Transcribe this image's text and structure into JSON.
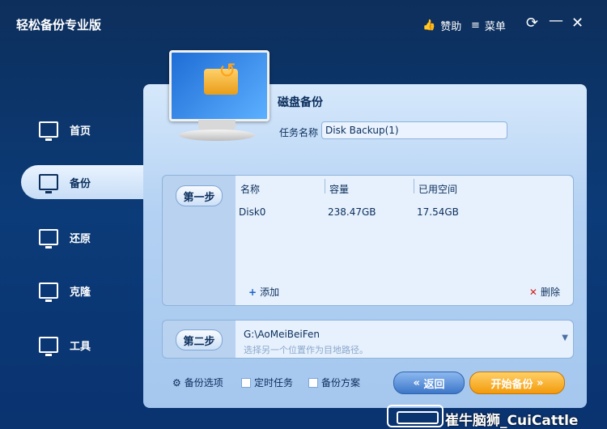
{
  "app": {
    "title": "轻松备份专业版"
  },
  "titlebar": {
    "donate_label": "赞助",
    "menu_label": "菜单",
    "refresh_icon": "refresh-icon",
    "minimize_icon": "minimize-icon",
    "close_icon": "close-icon"
  },
  "sidebar": {
    "items": [
      {
        "label": "首页",
        "icon": "home-monitor-icon",
        "active": false
      },
      {
        "label": "备份",
        "icon": "backup-monitor-icon",
        "active": true
      },
      {
        "label": "还原",
        "icon": "restore-monitor-icon",
        "active": false
      },
      {
        "label": "克隆",
        "icon": "clone-monitor-icon",
        "active": false
      },
      {
        "label": "工具",
        "icon": "tools-monitor-icon",
        "active": false
      }
    ]
  },
  "main": {
    "section_title": "磁盘备份",
    "task_name_label": "任务名称",
    "task_name_value": "Disk Backup(1)",
    "step1": {
      "label": "第一步",
      "columns": [
        "名称",
        "容量",
        "已用空间"
      ],
      "rows": [
        {
          "name": "Disk0",
          "capacity": "238.47GB",
          "used": "17.54GB"
        }
      ],
      "add_label": "添加",
      "delete_label": "删除"
    },
    "step2": {
      "label": "第二步",
      "path": "G:\\AoMeiBeiFen",
      "hint": "选择另一个位置作为目地路径。"
    },
    "options": {
      "backup_options": "备份选项",
      "scheduled_task": "定时任务",
      "backup_scheme": "备份方案"
    },
    "buttons": {
      "back": "返回",
      "start": "开始备份"
    }
  },
  "watermark": {
    "text": "崔牛脑狮_CuiCattle"
  },
  "colors": {
    "accent": "#f39a0c",
    "panel": "#b3d1f3",
    "title_bg": "#0b3b78",
    "text_dark": "#0b2e5c"
  }
}
